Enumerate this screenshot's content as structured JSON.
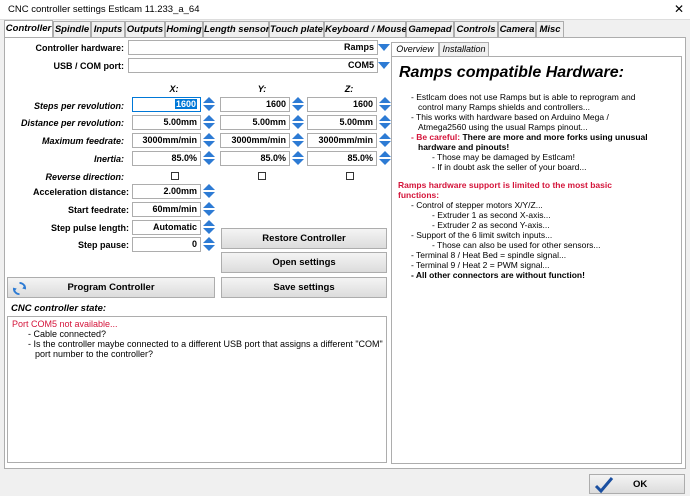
{
  "window": {
    "title": "CNC controller settings Estlcam 11.233_a_64",
    "close_glyph": "✕"
  },
  "tabs": [
    {
      "label": "Controller"
    },
    {
      "label": "Spindle"
    },
    {
      "label": "Inputs"
    },
    {
      "label": "Outputs"
    },
    {
      "label": "Homing"
    },
    {
      "label": "Length sensor"
    },
    {
      "label": "Touch plate"
    },
    {
      "label": "Keyboard / Mouse"
    },
    {
      "label": "Gamepad"
    },
    {
      "label": "Controls"
    },
    {
      "label": "Camera"
    },
    {
      "label": "Misc"
    }
  ],
  "controller": {
    "hardware_label": "Controller hardware:",
    "hardware_value": "Ramps",
    "port_label": "USB / COM port:",
    "port_value": "COM5"
  },
  "axes": {
    "x": "X:",
    "y": "Y:",
    "z": "Z:"
  },
  "params": {
    "steps_label": "Steps per revolution:",
    "steps": [
      "1600",
      "1600",
      "1600"
    ],
    "distance_label": "Distance per revolution:",
    "distance": [
      "5.00mm",
      "5.00mm",
      "5.00mm"
    ],
    "feedrate_label": "Maximum feedrate:",
    "feedrate": [
      "3000mm/min",
      "3000mm/min",
      "3000mm/min"
    ],
    "inertia_label": "Inertia:",
    "inertia": [
      "85.0%",
      "85.0%",
      "85.0%"
    ],
    "reverse_label": "Reverse direction:"
  },
  "extra": {
    "accel_label": "Acceleration distance:",
    "accel_value": "2.00mm",
    "start_label": "Start feedrate:",
    "start_value": "60mm/min",
    "pulse_label": "Step pulse length:",
    "pulse_value": "Automatic",
    "pause_label": "Step pause:",
    "pause_value": "0"
  },
  "buttons": {
    "restore": "Restore Controller",
    "open": "Open settings",
    "save": "Save settings",
    "program": "Program Controller",
    "ok": "OK"
  },
  "state": {
    "label": "CNC controller state:",
    "line1": "Port COM5 not available...",
    "line2": "- Cable connected?",
    "line3": "- Is the controller maybe connected to a different USB port that assigns a different \"COM\"",
    "line4": "port number to the controller?"
  },
  "overview": {
    "tab_overview": "Overview",
    "tab_install": "Installation",
    "heading": "Ramps compatible Hardware:",
    "l1": "- Estlcam does not use Ramps but is able to reprogram and",
    "l2": "control many Ramps shields and controllers...",
    "l3": "- This works with hardware based on Arduino Mega /",
    "l4": "Atmega2560 using the usual Ramps pinout...",
    "l5a": "- Be careful:",
    "l5b": " There are more and more forks using unusual",
    "l6": "hardware and pinouts!",
    "l7": "- Those may be damaged by Estlcam!",
    "l8": "- If in doubt ask the seller of your board...",
    "l9": "Ramps hardware support is limited to the most basic",
    "l10": "functions:",
    "l11": "- Control of stepper motors X/Y/Z...",
    "l12": "- Extruder 1 as second X-axis...",
    "l13": "- Extruder 2 as second Y-axis...",
    "l14": "- Support of the 6 limit switch inputs...",
    "l15": "- Those can also be used for other sensors...",
    "l16": "- Terminal 8 / Heat Bed = spindle signal...",
    "l17": "- Terminal 9 / Heat 2 = PWM signal...",
    "l18": "- All other connectors are without function!"
  },
  "colors": {
    "accent": "#2d7bd4",
    "warning": "#d4143a",
    "selection": "#0078d7"
  }
}
